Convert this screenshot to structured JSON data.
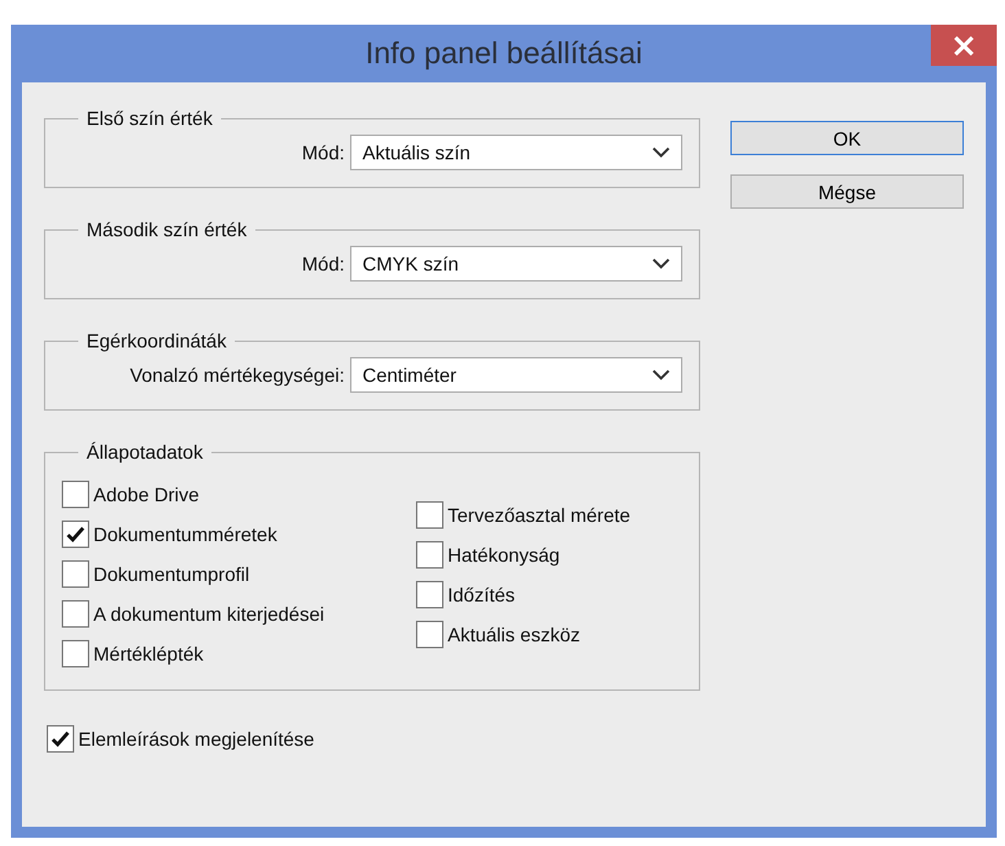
{
  "window": {
    "title": "Info panel beállításai",
    "close": "×"
  },
  "groups": [
    {
      "title": "Első szín érték",
      "kind": "select",
      "label": "Mód:",
      "value": "Aktuális szín"
    },
    {
      "title": "Második szín érték",
      "kind": "select",
      "label": "Mód:",
      "value": "CMYK szín"
    },
    {
      "title": "Egérkoordináták",
      "kind": "select",
      "label": "Vonalzó mértékegységei:",
      "value": "Centiméter"
    },
    {
      "title": "Állapotadatok",
      "kind": "checks",
      "columns": [
        [
          {
            "label": "Adobe Drive",
            "checked": false
          },
          {
            "label": "Dokumentumméretek",
            "checked": true
          },
          {
            "label": "Dokumentumprofil",
            "checked": false
          },
          {
            "label": "A dokumentum kiterjedései",
            "checked": false
          },
          {
            "label": "Mértéklépték",
            "checked": false
          }
        ],
        [
          {
            "label": "Tervezőasztal mérete",
            "checked": false
          },
          {
            "label": "Hatékonyság",
            "checked": false
          },
          {
            "label": "Időzítés",
            "checked": false
          },
          {
            "label": "Aktuális eszköz",
            "checked": false
          }
        ]
      ]
    }
  ],
  "tooltips_option": {
    "label": "Elemleírások megjelenítése",
    "checked": true
  },
  "buttons": [
    {
      "label": "OK",
      "default": true
    },
    {
      "label": "Mégse",
      "default": false
    }
  ]
}
